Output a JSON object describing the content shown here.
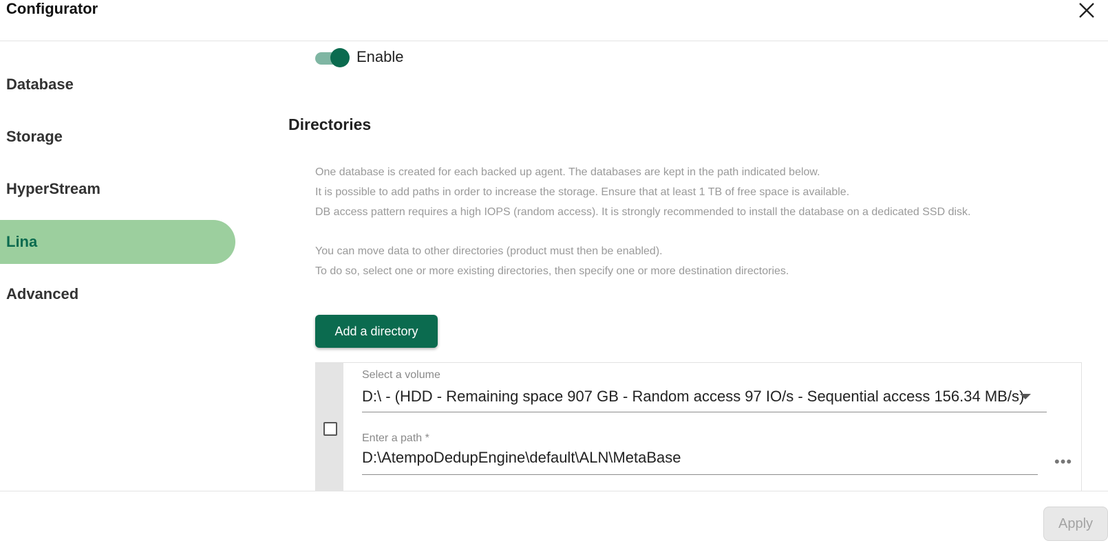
{
  "app": {
    "title": "Configurator"
  },
  "sidebar": {
    "items": [
      {
        "label": "Database",
        "active": false
      },
      {
        "label": "Storage",
        "active": false
      },
      {
        "label": "HyperStream",
        "active": false
      },
      {
        "label": "Lina",
        "active": true
      },
      {
        "label": "Advanced",
        "active": false
      }
    ]
  },
  "main": {
    "enable": {
      "label": "Enable",
      "checked": true
    },
    "directories": {
      "title": "Directories",
      "info_lines": [
        "One database is created for each backed up agent. The databases are kept in the path indicated below.",
        "It is possible to add paths in order to increase the storage. Ensure that at least 1 TB of free space is available.",
        "DB access pattern requires a high IOPS (random access). It is strongly recommended to install the database on a dedicated SSD disk.",
        "You can move data to other directories (product must then be enabled).",
        "To do so, select one or more existing directories, then specify one or more destination directories."
      ],
      "add_button": "Add a directory",
      "entry": {
        "volume_label": "Select a volume",
        "volume_value": "D:\\ - (HDD - Remaining space 907 GB - Random access 97 IO/s - Sequential access 156.34 MB/s)",
        "path_label": "Enter a path *",
        "path_value": "D:\\AtempoDedupEngine\\default\\ALN\\MetaBase",
        "more_label": "•••"
      }
    }
  },
  "footer": {
    "apply_label": "Apply"
  },
  "colors": {
    "accent": "#0b6b4f",
    "active_nav_bg": "#9ccf9e",
    "muted_text": "#9a9a9a"
  }
}
